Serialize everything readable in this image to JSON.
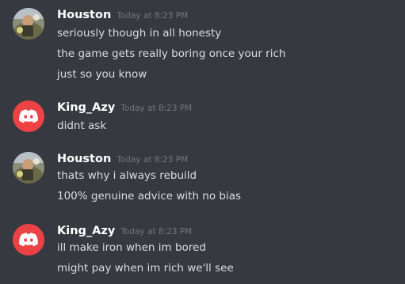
{
  "colors": {
    "background": "#36393f",
    "username": "#ffffff",
    "timestamp": "#72767d",
    "message_text": "#dcddde",
    "discord_avatar_bg": "#ed4245"
  },
  "messages": [
    {
      "author": "Houston",
      "timestamp": "Today at 8:23 PM",
      "avatar": "user-photo",
      "lines": [
        "seriously though in all honesty",
        "the game gets really boring once your rich",
        "just so you know"
      ]
    },
    {
      "author": "King_Azy",
      "timestamp": "Today at 8:23 PM",
      "avatar": "discord-default-icon",
      "lines": [
        "didnt ask"
      ]
    },
    {
      "author": "Houston",
      "timestamp": "Today at 8:23 PM",
      "avatar": "user-photo",
      "lines": [
        "thats why i always rebuild",
        "100% genuine advice with no bias"
      ]
    },
    {
      "author": "King_Azy",
      "timestamp": "Today at 8:23 PM",
      "avatar": "discord-default-icon",
      "lines": [
        "ill make iron when im bored",
        "might pay when im rich we'll see"
      ]
    }
  ]
}
